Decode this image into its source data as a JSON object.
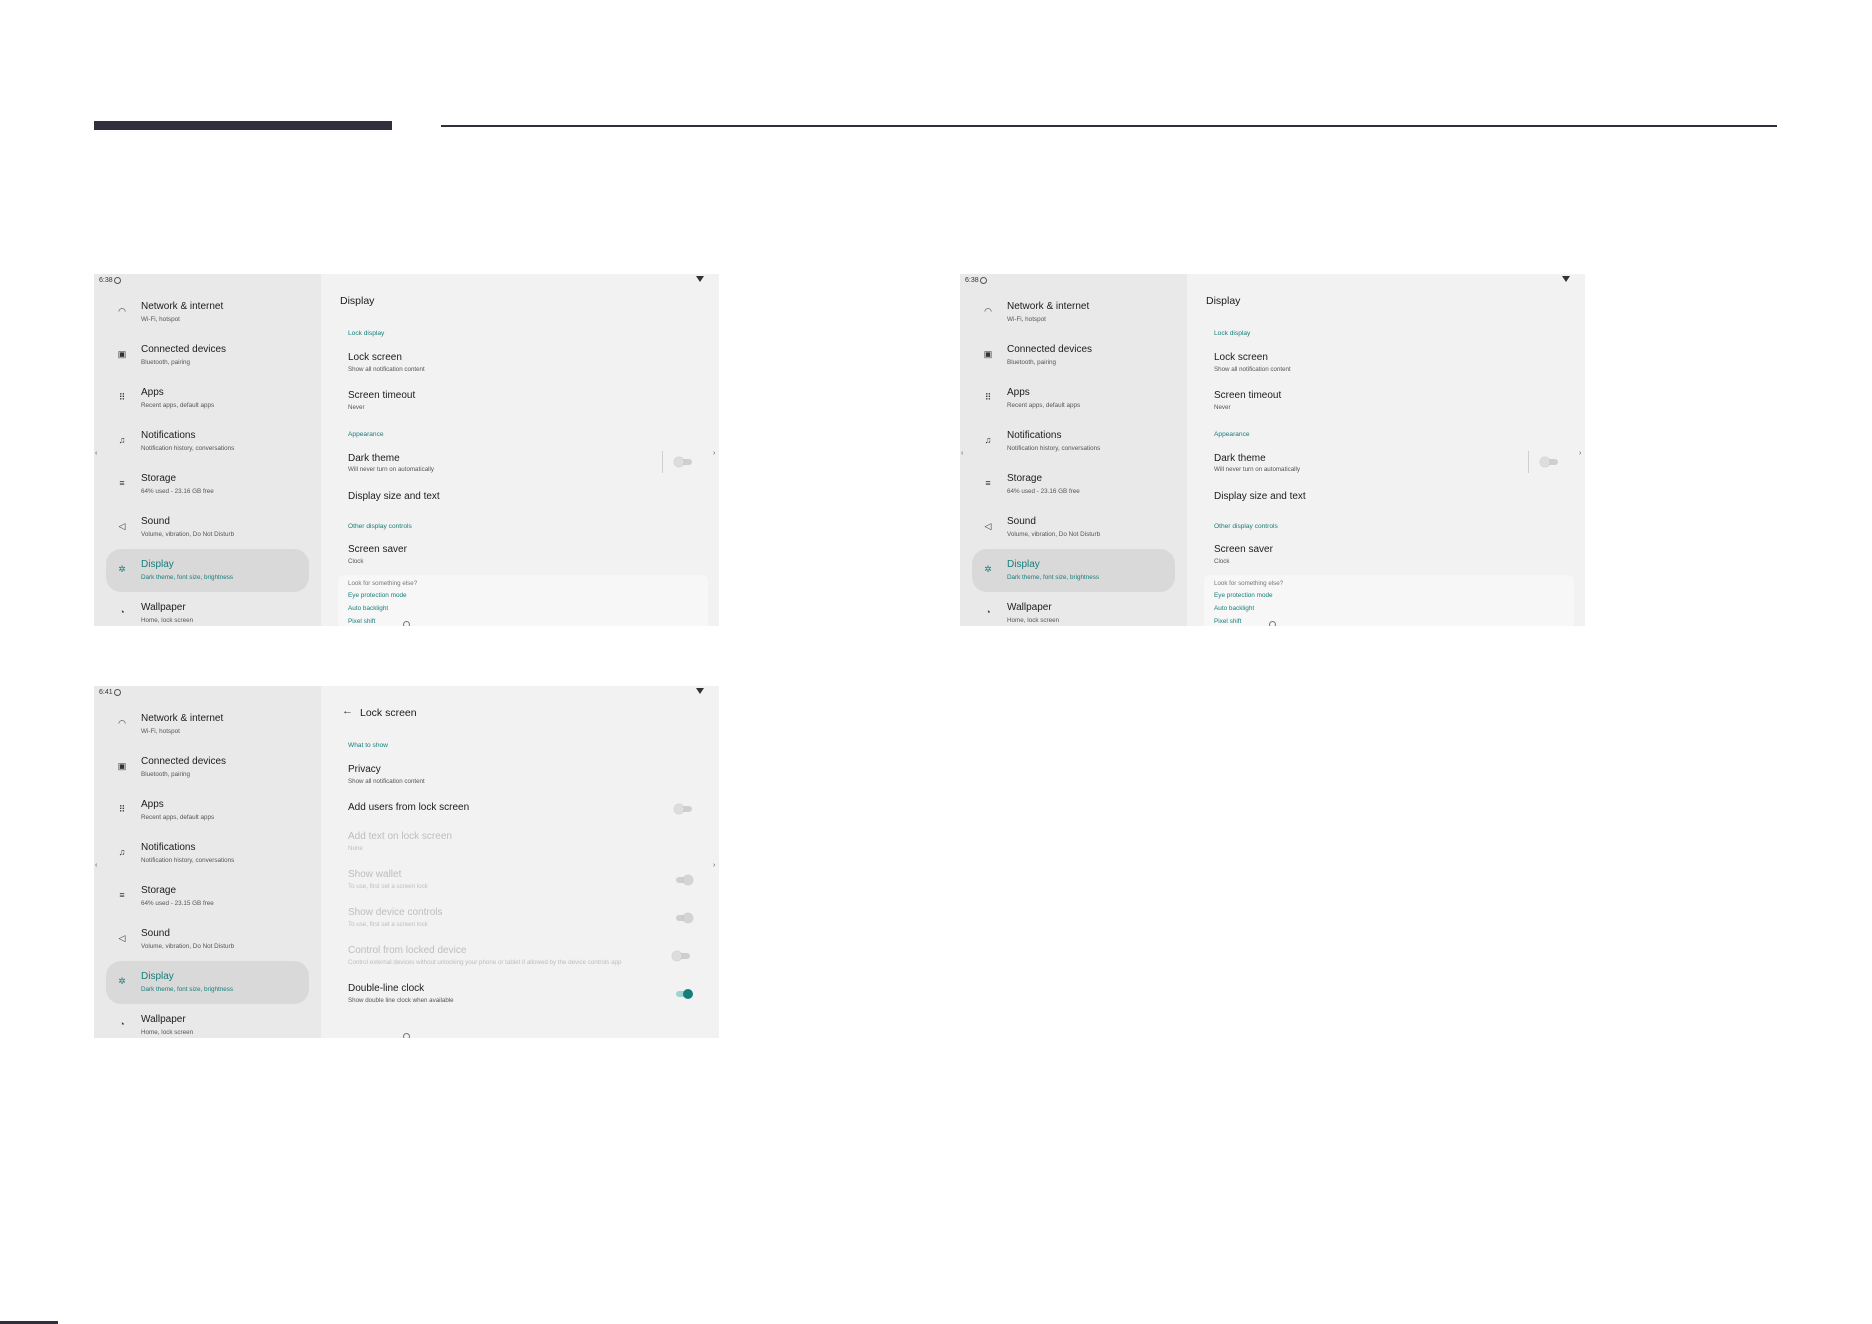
{
  "nav": [
    {
      "title": "Network & internet",
      "subtitle": "Wi-Fi, hotspot",
      "icon": "wifi-icon"
    },
    {
      "title": "Connected devices",
      "subtitle": "Bluetooth, pairing",
      "icon": "devices-icon"
    },
    {
      "title": "Apps",
      "subtitle": "Recent apps, default apps",
      "icon": "apps-grid-icon"
    },
    {
      "title": "Notifications",
      "subtitle": "Notification history, conversations",
      "icon": "bell-icon"
    },
    {
      "title": "Storage",
      "subtitle": "64% used - 23.16 GB free",
      "icon": "storage-icon"
    },
    {
      "title": "Sound",
      "subtitle": "Volume, vibration, Do Not Disturb",
      "icon": "speaker-icon"
    },
    {
      "title": "Display",
      "subtitle": "Dark theme, font size, brightness",
      "icon": "display-icon"
    },
    {
      "title": "Wallpaper",
      "subtitle": "Home, lock screen",
      "icon": "palette-icon"
    }
  ],
  "nav_storage_alt_subtitle": "64% used - 23.15 GB free",
  "display_screen": {
    "time": "6:38",
    "title": "Display",
    "sec_lock": "Lock display",
    "lock_screen": "Lock screen",
    "lock_screen_sub": "Show all notification content",
    "screen_timeout": "Screen timeout",
    "screen_timeout_sub": "Never",
    "sec_appearance": "Appearance",
    "dark_theme": "Dark theme",
    "dark_theme_sub": "Will never turn on automatically",
    "display_size": "Display size and text",
    "sec_other": "Other display controls",
    "screen_saver": "Screen saver",
    "screen_saver_sub": "Clock",
    "look_head": "Look for something else?",
    "look_links": [
      "Eye protection mode",
      "Auto backlight",
      "Pixel shift"
    ]
  },
  "lock_screen_screen": {
    "time": "6:41",
    "title": "Lock screen",
    "sec_what": "What to show",
    "privacy": "Privacy",
    "privacy_sub": "Show all notification content",
    "add_users": "Add users from lock screen",
    "add_text": "Add text on lock screen",
    "add_text_sub": "None",
    "show_wallet": "Show wallet",
    "show_wallet_sub": "To use, first set a screen lock",
    "show_device_controls": "Show device controls",
    "show_device_controls_sub": "To use, first set a screen lock",
    "control_locked": "Control from locked device",
    "control_locked_sub": "Control external devices without unlocking your phone or tablet if allowed by the device controls app",
    "double_clock": "Double-line clock",
    "double_clock_sub": "Show double line clock when available"
  },
  "colors": {
    "accent": "#167e7a",
    "header_bar": "#2f2f3e"
  }
}
